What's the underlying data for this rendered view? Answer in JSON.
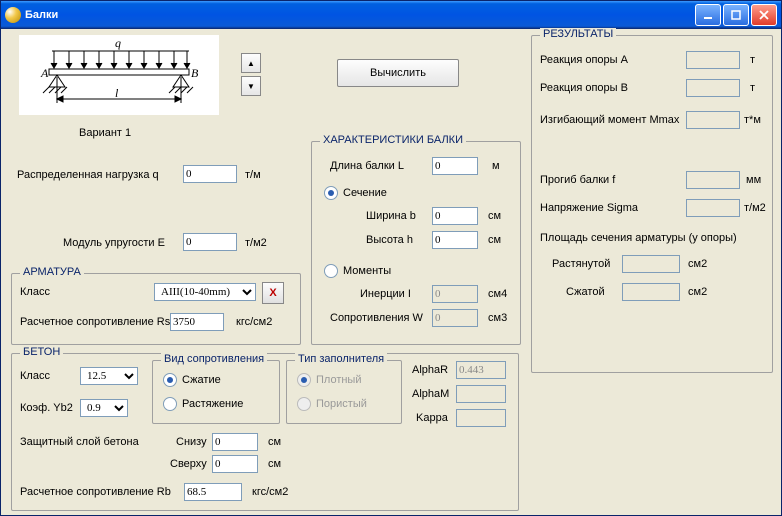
{
  "title": "Балки",
  "variant": "Вариант 1",
  "calc_btn": "Вычислить",
  "load": {
    "label": "Распределенная нагрузка  q",
    "value": "0",
    "unit": "т/м"
  },
  "modulus": {
    "label": "Модуль упругости  E",
    "value": "0",
    "unit": "т/м2"
  },
  "rebar": {
    "caption": "АРМАТУРА",
    "class_label": "Класс",
    "class_value": "AIII(10-40mm)",
    "rs_label": "Расчетное сопротивление Rs",
    "rs_value": "3750",
    "rs_unit": "кгс/см2",
    "del": "X"
  },
  "concrete": {
    "caption": "БЕТОН",
    "class_label": "Класс",
    "class_value": "12.5",
    "yb2_label": "Коэф. Yb2",
    "yb2_value": "0.9",
    "resist_label": "Вид сопротивления",
    "resist_comp": "Сжатие",
    "resist_tens": "Растяжение",
    "fill_label": "Тип заполнителя",
    "fill_dense": "Плотный",
    "fill_porous": "Пористый",
    "cover_label": "Защитный слой бетона",
    "cover_bottom_label": "Снизу",
    "cover_bottom_value": "0",
    "cover_top_label": "Сверху",
    "cover_top_value": "0",
    "cover_unit": "см",
    "rb_label": "Расчетное сопротивление Rb",
    "rb_value": "68.5",
    "rb_unit": "кгс/см2",
    "alphaR_label": "AlphaR",
    "alphaR_value": "0.443",
    "alphaM_label": "AlphaM",
    "alphaM_value": "",
    "kappa_label": "Kappa",
    "kappa_value": ""
  },
  "beam": {
    "caption": "ХАРАКТЕРИСТИКИ БАЛКИ",
    "len_label": "Длина балки L",
    "len_value": "0",
    "len_unit": "м",
    "section_label": "Сечение",
    "width_label": "Ширина  b",
    "width_value": "0",
    "height_label": "Высота  h",
    "height_value": "0",
    "bh_unit": "см",
    "moments_label": "Моменты",
    "inertia_label": "Инерции   I",
    "inertia_value": "0",
    "inertia_unit": "см4",
    "modulus_label": "Сопротивления  W",
    "modulus_value": "0",
    "modulus_unit": "см3"
  },
  "results": {
    "caption": "РЕЗУЛЬТАТЫ",
    "ra_label": "Реакция опоры A",
    "ra_unit": "т",
    "rb_label": "Реакция опоры B",
    "rb_unit": "т",
    "mmax_label": "Изгибающий момент Mmax",
    "mmax_unit": "т*м",
    "defl_label": "Прогиб балки   f",
    "defl_unit": "мм",
    "sigma_label": "Напряжение Sigma",
    "sigma_unit": "т/м2",
    "area_label": "Площадь сечения арматуры (у опоры)",
    "tension_label": "Растянутой",
    "compress_label": "Сжатой",
    "area_unit": "см2"
  },
  "diagram": {
    "q": "q",
    "A": "A",
    "B": "B",
    "l": "l"
  }
}
